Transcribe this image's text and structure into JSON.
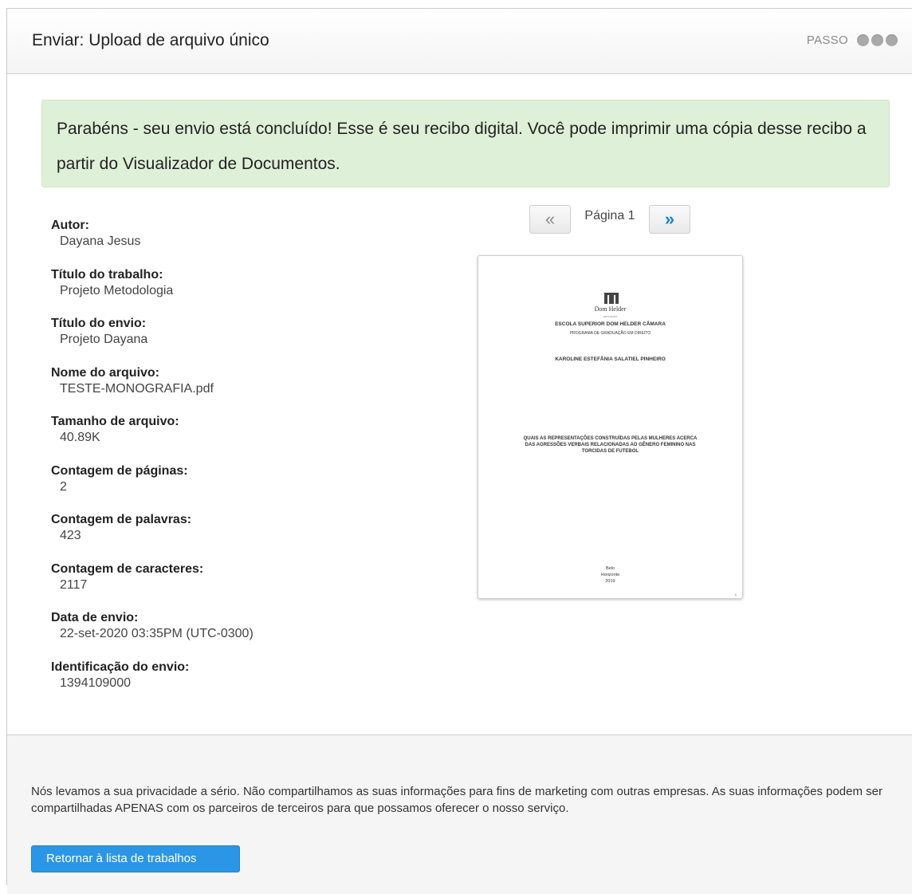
{
  "header": {
    "title": "Enviar: Upload de arquivo único",
    "steps_label": "PASSO"
  },
  "alert": {
    "message": "Parabéns - seu envio está concluído! Esse é seu recibo digital. Você pode imprimir uma cópia desse recibo a partir do Visualizador de Documentos."
  },
  "receipt": [
    {
      "label": "Autor:",
      "value": "Dayana Jesus"
    },
    {
      "label": "Título do trabalho:",
      "value": "Projeto Metodologia"
    },
    {
      "label": "Título do envio:",
      "value": "Projeto Dayana"
    },
    {
      "label": "Nome do arquivo:",
      "value": "TESTE-MONOGRAFIA.pdf"
    },
    {
      "label": "Tamanho de arquivo:",
      "value": "40.89K"
    },
    {
      "label": "Contagem de páginas:",
      "value": "2"
    },
    {
      "label": "Contagem de palavras:",
      "value": "423"
    },
    {
      "label": "Contagem de caracteres:",
      "value": "2117"
    },
    {
      "label": "Data de envio:",
      "value": "22-set-2020 03:35PM (UTC-0300)"
    },
    {
      "label": "Identificação do envio:",
      "value": "1394109000"
    }
  ],
  "viewer": {
    "prev_glyph": "«",
    "page_label": "Página 1",
    "next_glyph": "»"
  },
  "preview": {
    "institution": "Dom Helder",
    "sub": "EDUCAÇÃO",
    "school": "ESCOLA SUPERIOR DOM HELDER CÂMARA",
    "program": "PROGRAMA DE GRADUAÇÃO EM DIREITO",
    "author": "KAROLINE ESTEFÂNIA SALATIEL PINHEIRO",
    "work_title": "QUAIS AS REPRESENTAÇÕES CONSTRUÍDAS PELAS MULHERES ACERCA DAS AGRESSÕES VERBAIS RELACIONADAS AO GÊNERO FEMININO NAS TORCIDAS DE FUTEBOL",
    "city_1": "Belo",
    "city_2": "Horizonte",
    "year": "2019",
    "page_number": "1"
  },
  "footer": {
    "privacy": "Nós levamos a sua privacidade a sério. Não compartilhamos as suas informações para fins de marketing com outras empresas. As suas informações podem ser compartilhadas APENAS com os parceiros de terceiros para que possamos oferecer o nosso serviço.",
    "button_label": "Retornar à lista de trabalhos"
  },
  "colors": {
    "alert_bg": "#dff0d8",
    "primary": "#2b96e6",
    "link": "#1a82d8"
  }
}
